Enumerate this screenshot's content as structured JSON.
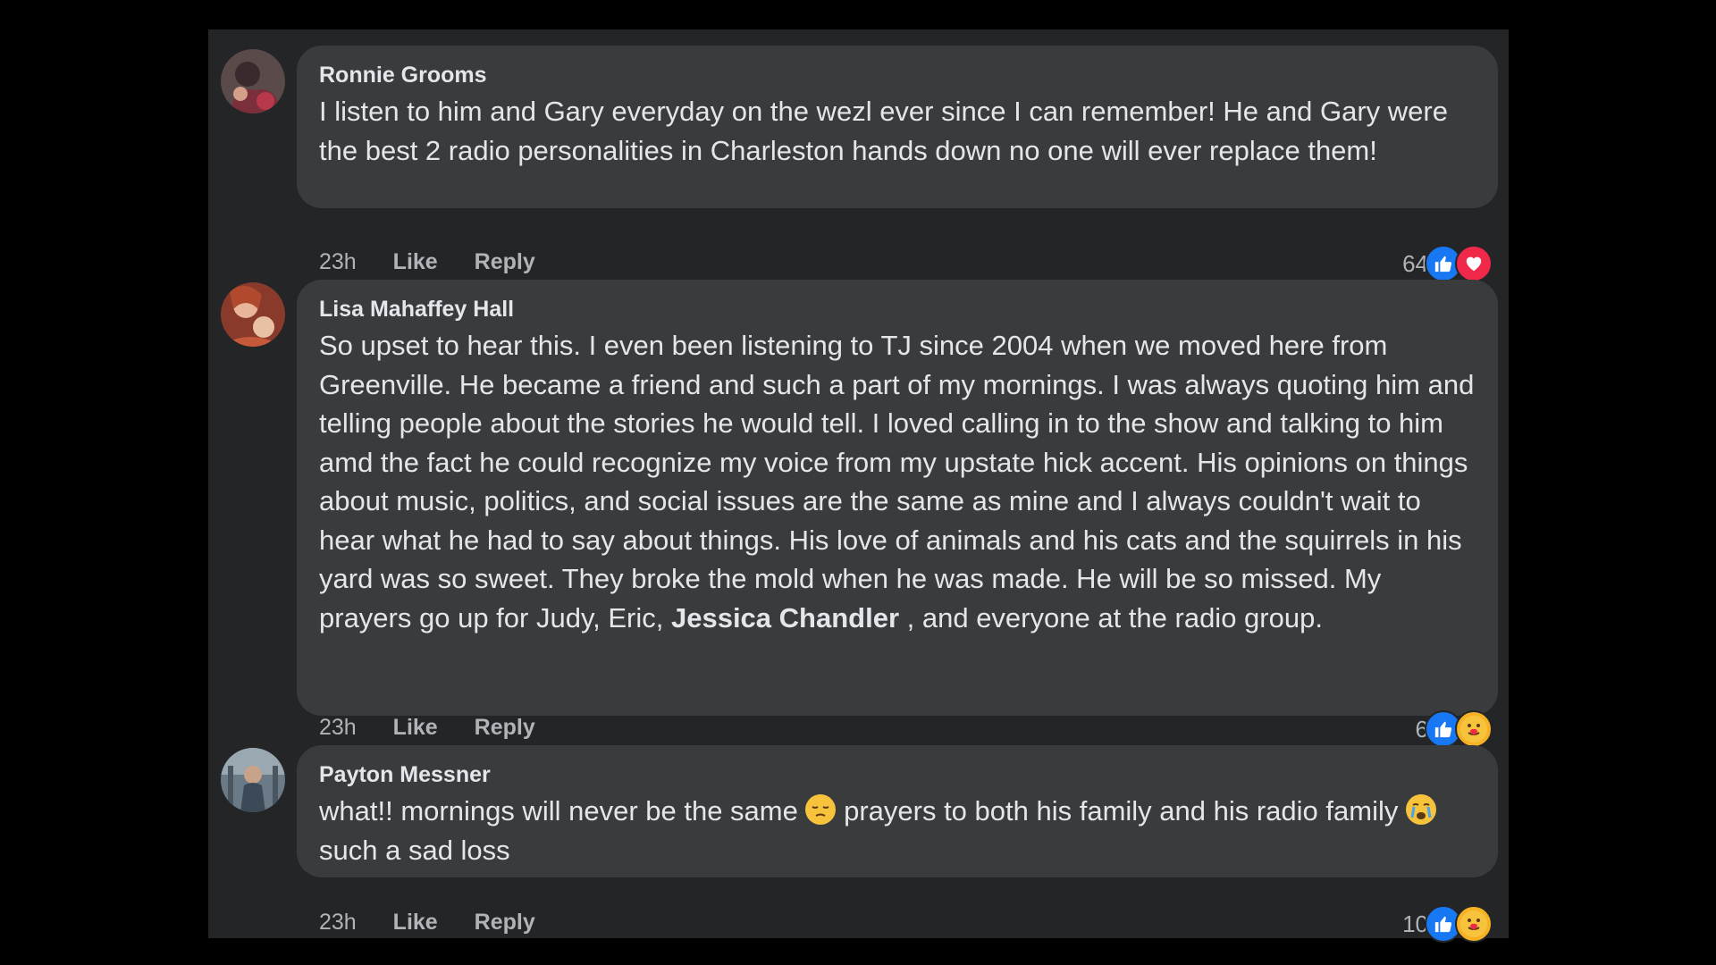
{
  "comments": [
    {
      "author": "Ronnie Grooms",
      "text": "I listen to him and Gary everyday on the wezl ever since I can remember! He and Gary were the best 2 radio personalities in Charleston hands down no one will ever replace them!",
      "time": "23h",
      "like_label": "Like",
      "reply_label": "Reply",
      "reaction_count": "64",
      "reactions": [
        "like-icon",
        "love-icon"
      ]
    },
    {
      "author": "Lisa Mahaffey Hall",
      "text_part1": "So upset to hear this. I even been listening to TJ since 2004 when we moved here from Greenville. He became a friend and such a part of my mornings. I was always quoting him and telling people about the stories he would tell. I loved calling in to the show and talking to him amd the fact he could recognize my voice from my upstate hick accent. His opinions on things about music, politics, and social issues are the same as mine and I always couldn't wait to hear what he had to say about things. His love of animals and his cats and the squirrels in his yard was so sweet. They broke the mold when he was made. He will be so missed. My prayers go up for Judy, Eric, ",
      "mention": "Jessica Chandler",
      "text_part2": " , and everyone at the radio group.",
      "time": "23h",
      "like_label": "Like",
      "reply_label": "Reply",
      "reaction_count": "6",
      "reactions": [
        "like-icon",
        "care-icon"
      ]
    },
    {
      "author": "Payton Messner",
      "text_part1": "what!! mornings will never be the same ",
      "emoji1": "pensive-face-icon",
      "text_part2": " prayers to both his family and his radio family ",
      "emoji2": "crying-face-icon",
      "text_part3": " such a sad loss",
      "time": "23h",
      "like_label": "Like",
      "reply_label": "Reply",
      "reaction_count": "10",
      "reactions": [
        "like-icon",
        "care-icon"
      ]
    }
  ],
  "colors": {
    "background": "#000000",
    "panel": "#242526",
    "bubble": "#3a3b3c",
    "text": "#e4e6eb",
    "secondary_text": "#b0b3b8",
    "like_blue": "#1877f2",
    "love_red": "#f02849",
    "care_yellow": "#f7b125"
  }
}
